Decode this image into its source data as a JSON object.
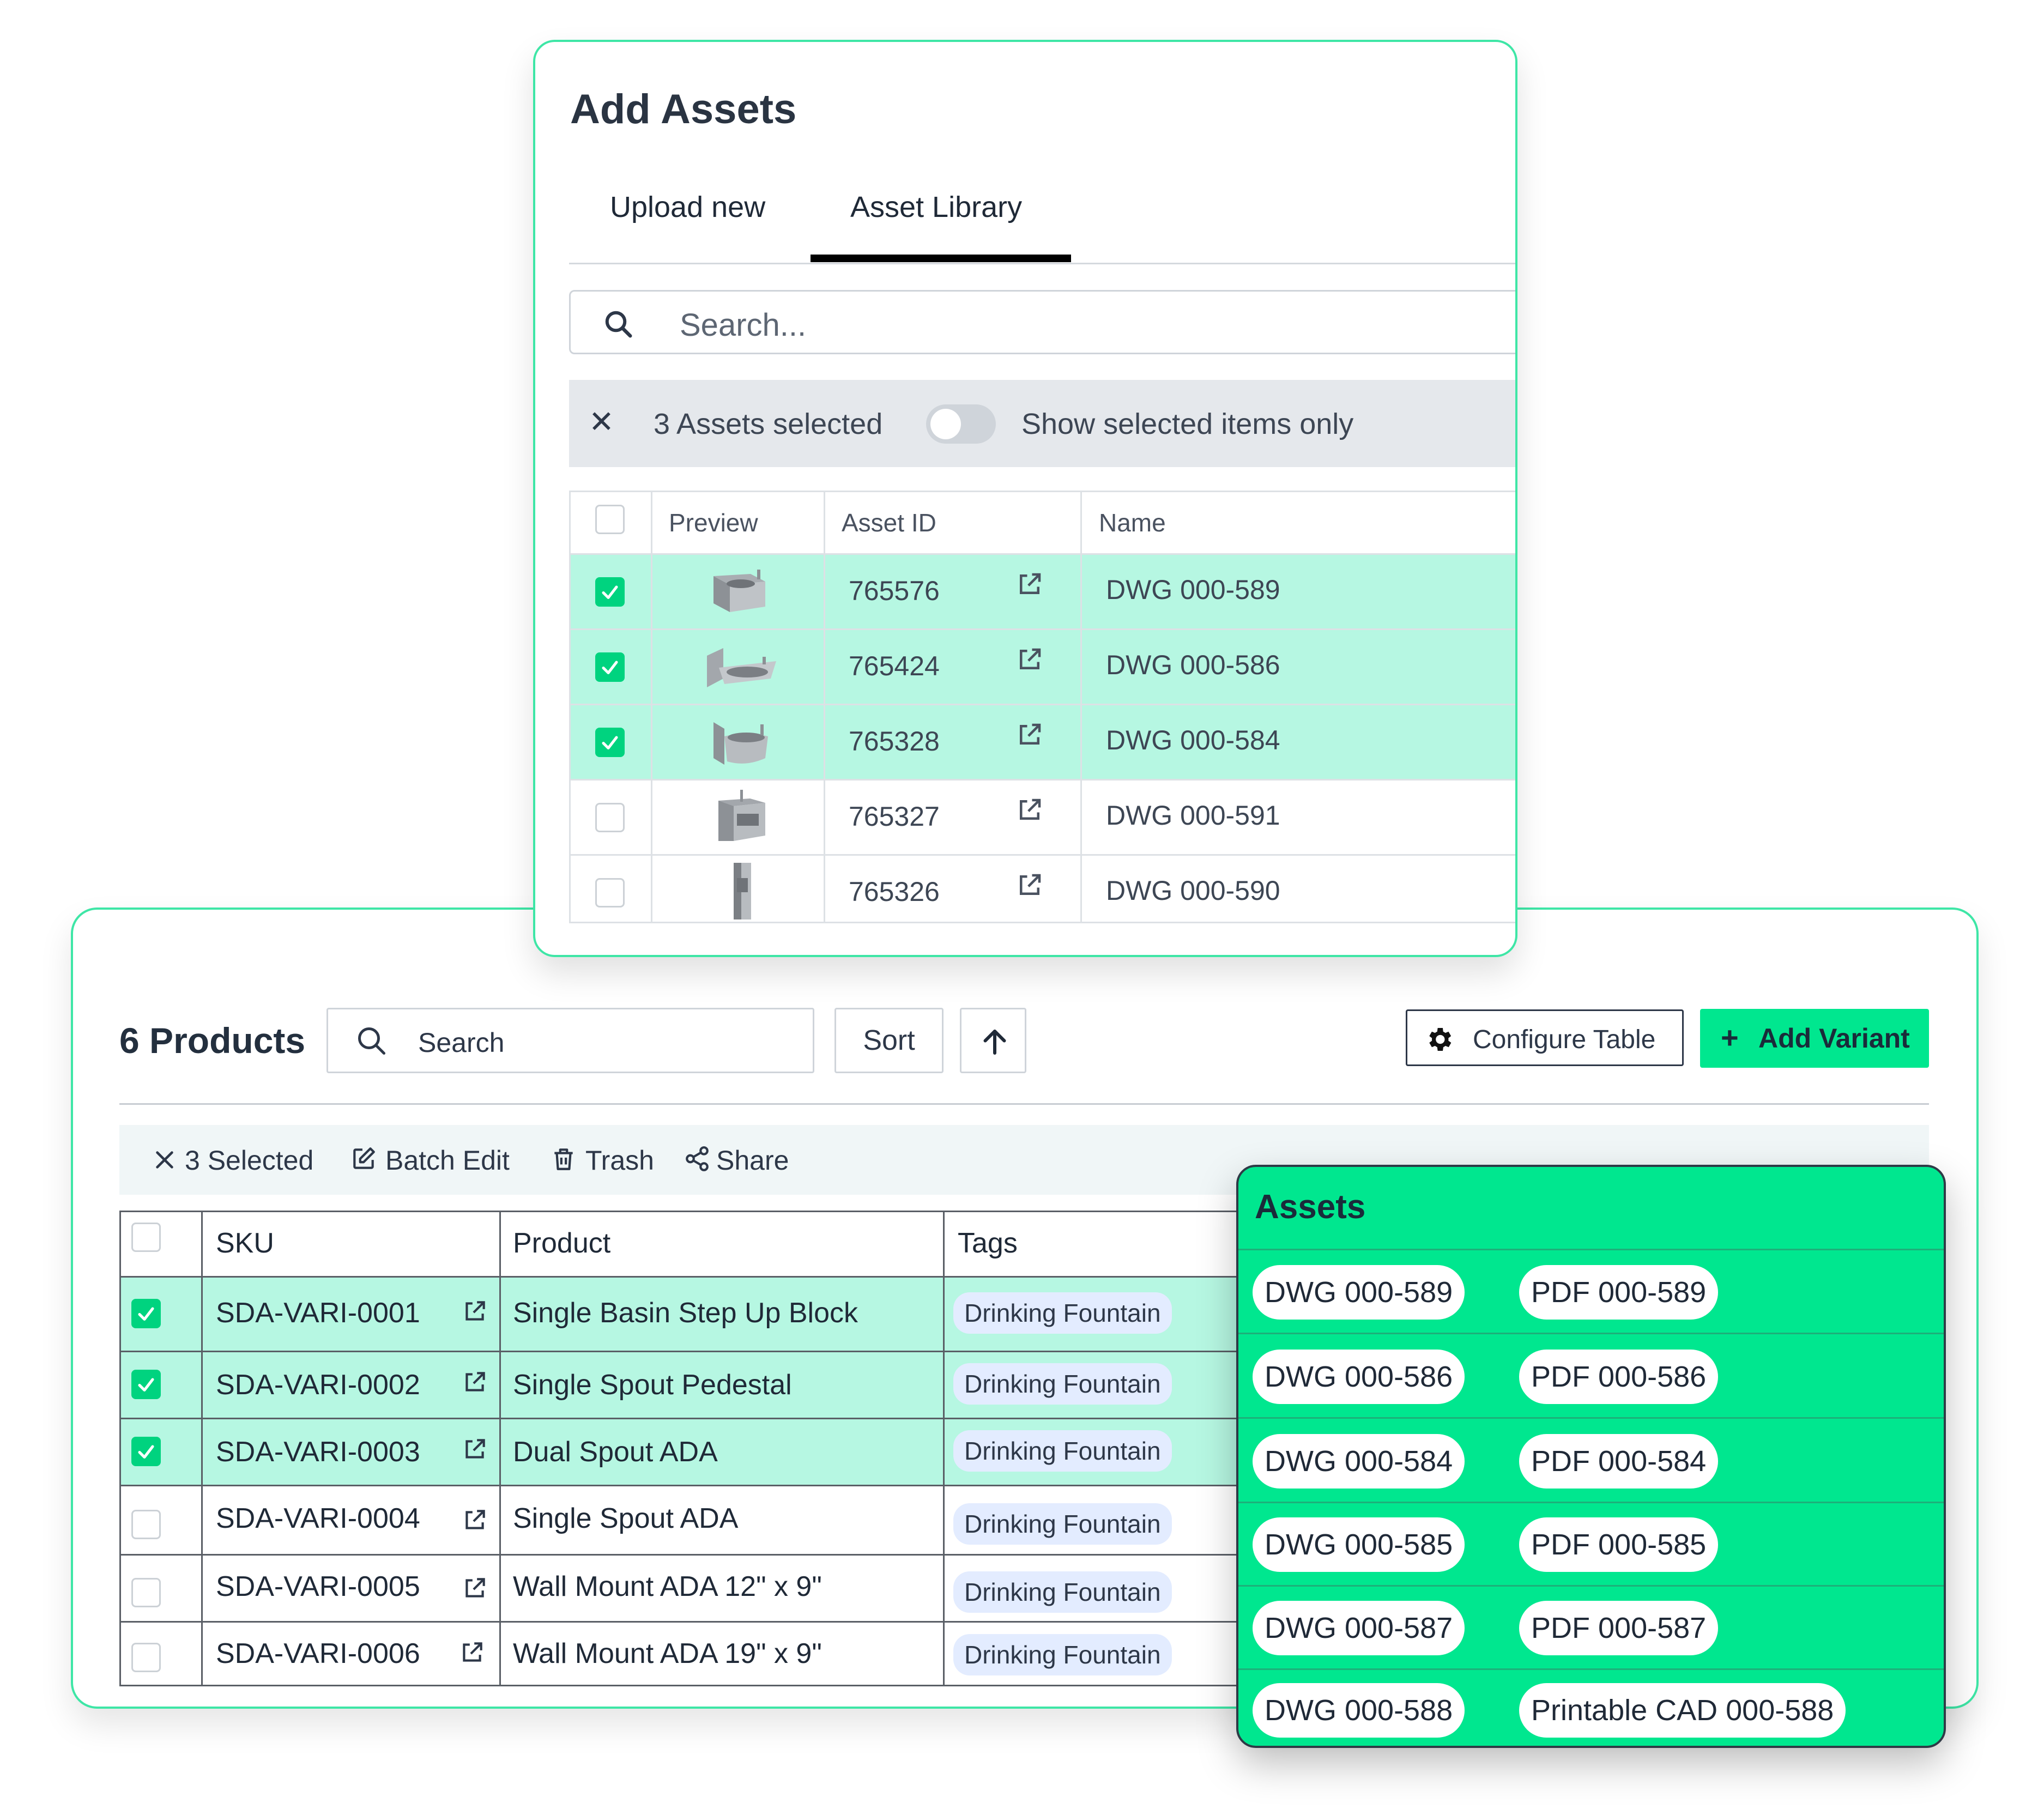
{
  "products_panel": {
    "title": "6 Products",
    "search_placeholder": "Search",
    "sort_label": "Sort",
    "configure_table_label": "Configure Table",
    "add_variant_label": "Add Variant",
    "add_variant_plus": "+",
    "selection_bar": {
      "selected_label": "3 Selected",
      "batch_edit_label": "Batch Edit",
      "trash_label": "Trash",
      "share_label": "Share"
    },
    "table": {
      "columns": [
        "SKU",
        "Product",
        "Tags"
      ],
      "rows": [
        {
          "sku": "SDA-VARI-0001",
          "product": "Single Basin Step Up Block",
          "tag": "Drinking Fountain",
          "selected": true
        },
        {
          "sku": "SDA-VARI-0002",
          "product": "Single Spout Pedestal",
          "tag": "Drinking Fountain",
          "selected": true
        },
        {
          "sku": "SDA-VARI-0003",
          "product": "Dual Spout ADA",
          "tag": "Drinking Fountain",
          "selected": true
        },
        {
          "sku": "SDA-VARI-0004",
          "product": "Single Spout ADA",
          "tag": "Drinking Fountain",
          "selected": false
        },
        {
          "sku": "SDA-VARI-0005",
          "product": "Wall Mount ADA 12\" x 9\"",
          "tag": "Drinking Fountain",
          "selected": false
        },
        {
          "sku": "SDA-VARI-0006",
          "product": "Wall Mount ADA 19\" x 9\"",
          "tag": "Drinking Fountain",
          "selected": false
        }
      ]
    }
  },
  "assets_popover": {
    "title": "Assets",
    "rows": [
      [
        "DWG 000-589",
        "PDF 000-589"
      ],
      [
        "DWG 000-586",
        "PDF 000-586"
      ],
      [
        "DWG 000-584",
        "PDF 000-584"
      ],
      [
        "DWG 000-585",
        "PDF 000-585"
      ],
      [
        "DWG 000-587",
        "PDF 000-587"
      ],
      [
        "DWG 000-588",
        "Printable CAD 000-588"
      ]
    ]
  },
  "add_assets_modal": {
    "title": "Add Assets",
    "tabs": [
      {
        "label": "Upload new",
        "active": false
      },
      {
        "label": "Asset Library",
        "active": true
      }
    ],
    "search_placeholder": "Search...",
    "selection": {
      "close_glyph": "✕",
      "count_label": "3 Assets selected",
      "toggle_label": "Show selected items only",
      "toggle_on": false
    },
    "table": {
      "columns": [
        "Preview",
        "Asset ID",
        "Name"
      ],
      "rows": [
        {
          "asset_id": "765576",
          "name": "DWG 000-589",
          "selected": true,
          "preview": "wall-basin-fountain"
        },
        {
          "asset_id": "765424",
          "name": "DWG 000-586",
          "selected": true,
          "preview": "wall-basin-fountain"
        },
        {
          "asset_id": "765328",
          "name": "DWG 000-584",
          "selected": true,
          "preview": "wall-basin-fountain"
        },
        {
          "asset_id": "765327",
          "name": "DWG 000-591",
          "selected": false,
          "preview": "box-fountain"
        },
        {
          "asset_id": "765326",
          "name": "DWG 000-590",
          "selected": false,
          "preview": "pedestal-fountain"
        }
      ]
    }
  },
  "colors": {
    "accent_green": "#00e78f",
    "selected_row": "#b6f7e2",
    "checkbox_checked": "#00d37f",
    "tag_background": "#e3ecff",
    "card_border": "#3ee6a6"
  }
}
